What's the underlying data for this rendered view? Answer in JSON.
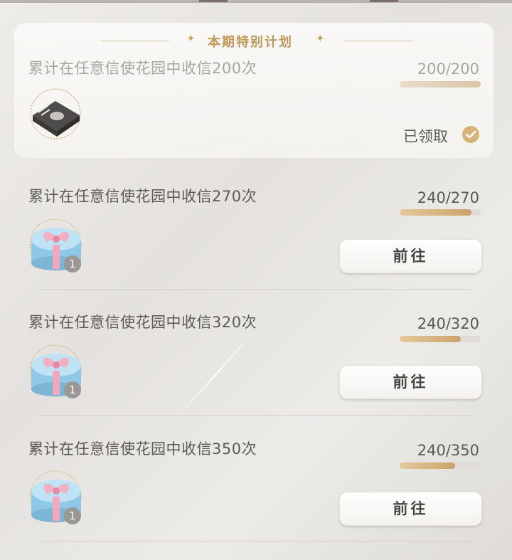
{
  "section_title": "本期特别计划",
  "decor_star": "✦",
  "colors": {
    "accent_gold": "#c19a5b",
    "progress_fill": "#caa36a",
    "text": "#5d5955"
  },
  "tasks": [
    {
      "text": "累计在任意信使花园中收信200次",
      "progress_text": "200/200",
      "progress": 1.0,
      "reward_icon": "dark-box-icon",
      "reward_count": "",
      "status": "已领取",
      "status_icon": "check-icon"
    },
    {
      "text": "累计在任意信使花园中收信270次",
      "progress_text": "240/270",
      "progress": 0.889,
      "reward_icon": "gift-box-icon",
      "reward_count": "1",
      "button": "前往"
    },
    {
      "text": "累计在任意信使花园中收信320次",
      "progress_text": "240/320",
      "progress": 0.75,
      "reward_icon": "gift-box-icon",
      "reward_count": "1",
      "button": "前往"
    },
    {
      "text": "累计在任意信使花园中收信350次",
      "progress_text": "240/350",
      "progress": 0.686,
      "reward_icon": "gift-box-icon",
      "reward_count": "1",
      "button": "前往"
    }
  ]
}
